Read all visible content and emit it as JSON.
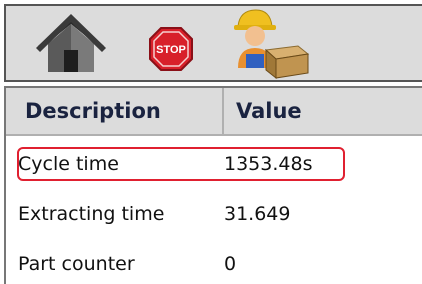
{
  "toolbar": {
    "buttons": [
      {
        "name": "home",
        "icon": "house-icon"
      },
      {
        "name": "stop",
        "icon": "stop-sign-icon",
        "label": "STOP"
      },
      {
        "name": "operator",
        "icon": "worker-with-box-icon"
      }
    ]
  },
  "table": {
    "columns": [
      "Description",
      "Value"
    ],
    "rows": [
      {
        "description": "Cycle time",
        "value": "1353.48s"
      },
      {
        "description": "Extracting time",
        "value": "31.649"
      },
      {
        "description": "Part counter",
        "value": "0"
      }
    ],
    "highlighted_row": 0
  },
  "colors": {
    "header_bg": "#dcdcdc",
    "header_text": "#1a2340",
    "highlight_border": "#e02030",
    "stop_red": "#d8202a"
  }
}
